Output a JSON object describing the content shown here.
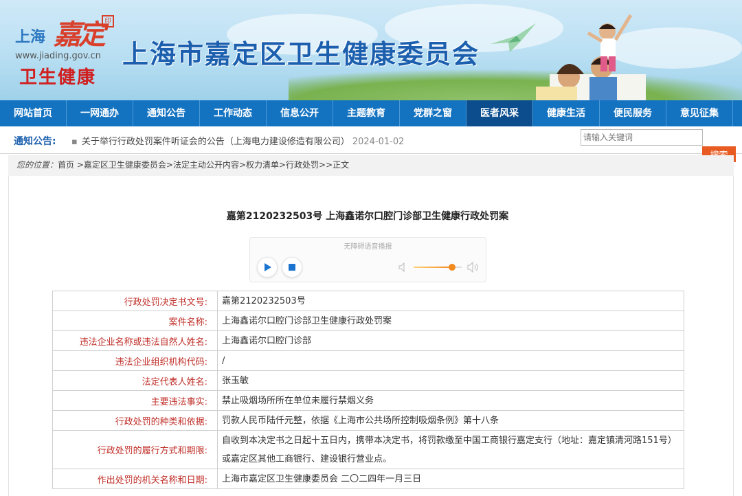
{
  "header": {
    "logo_city": "上海",
    "logo_mark": "嘉定",
    "logo_url": "www.jiading.gov.cn",
    "logo_sub": "卫生健康",
    "site_title": "上海市嘉定区卫生健康委员会",
    "banner_color": "#bfe2f4",
    "title_color": "#1b5fae"
  },
  "nav": {
    "items": [
      {
        "label": "网站首页"
      },
      {
        "label": "一网通办"
      },
      {
        "label": "通知公告"
      },
      {
        "label": "工作动态"
      },
      {
        "label": "信息公开"
      },
      {
        "label": "主题教育"
      },
      {
        "label": "党群之窗"
      },
      {
        "label": "医者风采",
        "active": true
      },
      {
        "label": "健康生活"
      },
      {
        "label": "便民服务"
      },
      {
        "label": "意见征集"
      }
    ],
    "bg_color": "#1473c1",
    "active_color": "#0b4d8d"
  },
  "notice": {
    "label": "通知公告:",
    "bullet": "▪",
    "item_text": "关于举行行政处罚案件听证会的公告（上海电力建设修造有限公司）",
    "item_date": "2024-01-02"
  },
  "search": {
    "placeholder": "请输入关键词",
    "button_label": "搜索",
    "button_color": "#e85b22"
  },
  "breadcrumb": {
    "label": "您的位置：",
    "path": "首页 >嘉定区卫生健康委员会>法定主动公开内容>权力清单>行政处罚>>正文"
  },
  "document": {
    "title": "嘉第2120232503号 上海鑫诺尔口腔门诊部卫生健康行政处罚案"
  },
  "player": {
    "label": "无障碍语音播报",
    "volume": 0.8,
    "play_icon": "play-icon",
    "stop_icon": "stop-icon"
  },
  "info_table": {
    "key_color": "#c0302a",
    "rows": [
      {
        "key": "行政处罚决定书文号:",
        "value": "嘉第2120232503号"
      },
      {
        "key": "案件名称:",
        "value": "上海鑫诺尔口腔门诊部卫生健康行政处罚案"
      },
      {
        "key": "违法企业名称或违法自然人姓名:",
        "value": "上海鑫诺尔口腔门诊部"
      },
      {
        "key": "违法企业组织机构代码:",
        "value": "/"
      },
      {
        "key": "法定代表人姓名:",
        "value": "张玉敏"
      },
      {
        "key": "主要违法事实:",
        "value": "禁止吸烟场所所在单位未履行禁烟义务"
      },
      {
        "key": "行政处罚的种类和依据:",
        "value": "罚款人民币陆仟元整，依据《上海市公共场所控制吸烟条例》第十八条"
      },
      {
        "key": "行政处罚的履行方式和期限:",
        "value": "自收到本决定书之日起十五日内，携带本决定书，将罚款缴至中国工商银行嘉定支行（地址：嘉定镇清河路151号）或嘉定区其他工商银行、建设银行营业点。"
      },
      {
        "key": "作出处罚的机关名称和日期:",
        "value": "上海市嘉定区卫生健康委员会 二〇二四年一月三日"
      }
    ]
  }
}
